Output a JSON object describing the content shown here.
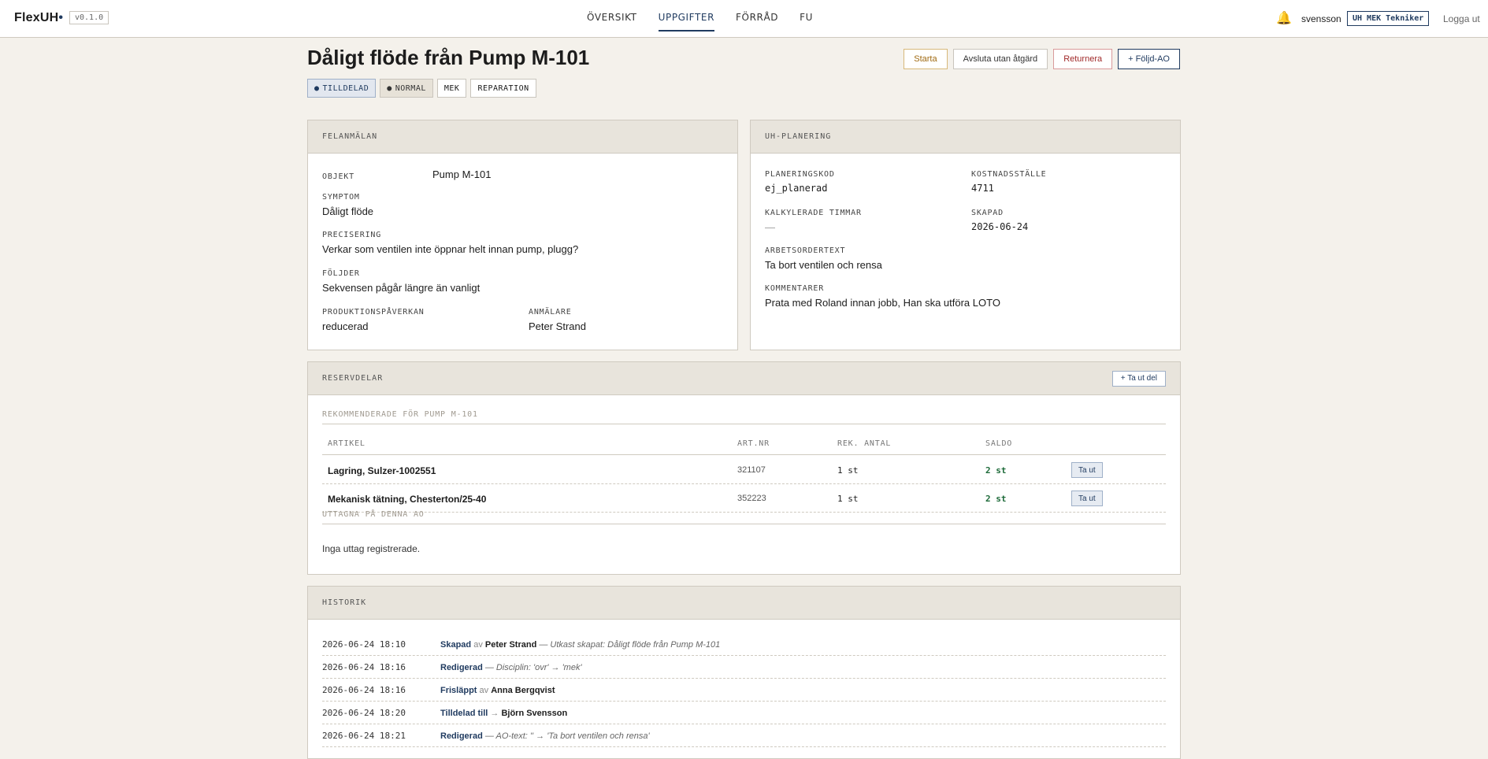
{
  "header": {
    "brand": "FlexUH",
    "brand_dot": "•",
    "version": "v0.1.0",
    "nav": [
      {
        "label": "ÖVERSIKT"
      },
      {
        "label": "UPPGIFTER"
      },
      {
        "label": "FÖRRÅD"
      },
      {
        "label": "FU"
      }
    ],
    "active_nav": "UPPGIFTER",
    "bell_icon": "🔔",
    "user": "svensson",
    "role": "UH MEK Tekniker",
    "logout": "Logga ut"
  },
  "order": {
    "title": "Dåligt flöde från Pump M-101",
    "actions": {
      "start": "Starta",
      "close_no_action": "Avsluta utan åtgärd",
      "return": "Returnera",
      "follow_up": "+ Följd-AO"
    },
    "tags": {
      "status": "TILLDELAD",
      "priority": "NORMAL",
      "discipline": "MEK",
      "type": "REPARATION"
    }
  },
  "fault_report": {
    "title": "FELANMÄLAN",
    "object_label": "OBJEKT",
    "object_value": "Pump M-101",
    "symptom_label": "SYMPTOM",
    "symptom_value": "Dåligt flöde",
    "precision_label": "PRECISERING",
    "precision_value": "Verkar som ventilen inte öppnar helt innan pump, plugg?",
    "consequence_label": "FÖLJDER",
    "consequence_value": "Sekvensen pågår längre än vanligt",
    "impact_label": "PRODUKTIONSPÅVERKAN",
    "impact_value": "reducerad",
    "reporter_label": "ANMÄLARE",
    "reporter_value": "Peter Strand"
  },
  "planning": {
    "title": "UH-PLANERING",
    "planning_code_label": "PLANERINGSKOD",
    "planning_code_value": "ej_planerad",
    "cost_center_label": "KOSTNADSSTÄLLE",
    "cost_center_value": "4711",
    "calc_hours_label": "KALKYLERADE TIMMAR",
    "calc_hours_value": "—",
    "created_label": "SKAPAD",
    "created_value": "2026-06-24",
    "work_text_label": "ARBETSORDERTEXT",
    "work_text_value": "Ta bort ventilen och rensa",
    "comments_label": "KOMMENTARER",
    "comments_value": "Prata med Roland innan jobb, Han ska utföra LOTO"
  },
  "spare_parts": {
    "title": "RESERVDELAR",
    "take_out_part": "+ Ta ut del",
    "recommended_label": "REKOMMENDERADE FÖR PUMP M-101",
    "columns": {
      "article": "ARTIKEL",
      "art_nr": "ART.NR",
      "rec_qty": "REK. ANTAL",
      "balance": "SALDO"
    },
    "rows": [
      {
        "article": "Lagring, Sulzer-1002551",
        "art_nr": "321107",
        "rec_qty": "1 st",
        "balance": "2 st",
        "action": "Ta ut"
      },
      {
        "article": "Mekanisk tätning, Chesterton/25-40",
        "art_nr": "352223",
        "rec_qty": "1 st",
        "balance": "2 st",
        "action": "Ta ut"
      }
    ],
    "withdrawn_label": "UTTAGNA PÅ DENNA AO",
    "no_withdrawals": "Inga uttag registrerade."
  },
  "history": {
    "title": "HISTORIK",
    "entries": [
      {
        "time": "2026-06-24 18:10",
        "action": "Skapad",
        "by": "av",
        "name": "Peter Strand",
        "note": "— Utkast skapat: Dåligt flöde från Pump M-101"
      },
      {
        "time": "2026-06-24 18:16",
        "action": "Redigerad",
        "by": "",
        "name": "",
        "note": "— Disciplin: 'ovr' → 'mek'"
      },
      {
        "time": "2026-06-24 18:16",
        "action": "Frisläppt",
        "by": "av",
        "name": "Anna Bergqvist",
        "note": ""
      },
      {
        "time": "2026-06-24 18:20",
        "action": "Tilldelad till",
        "by": "→",
        "name": "Björn Svensson",
        "note": ""
      },
      {
        "time": "2026-06-24 18:21",
        "action": "Redigerad",
        "by": "",
        "name": "",
        "note": "— AO-text: '' → 'Ta bort ventilen och rensa'"
      }
    ]
  },
  "colors": {
    "accent": "#1f3a5f",
    "balance_ok": "#1e6b3a",
    "return": "#a12a2a",
    "start": "#a06a12"
  }
}
